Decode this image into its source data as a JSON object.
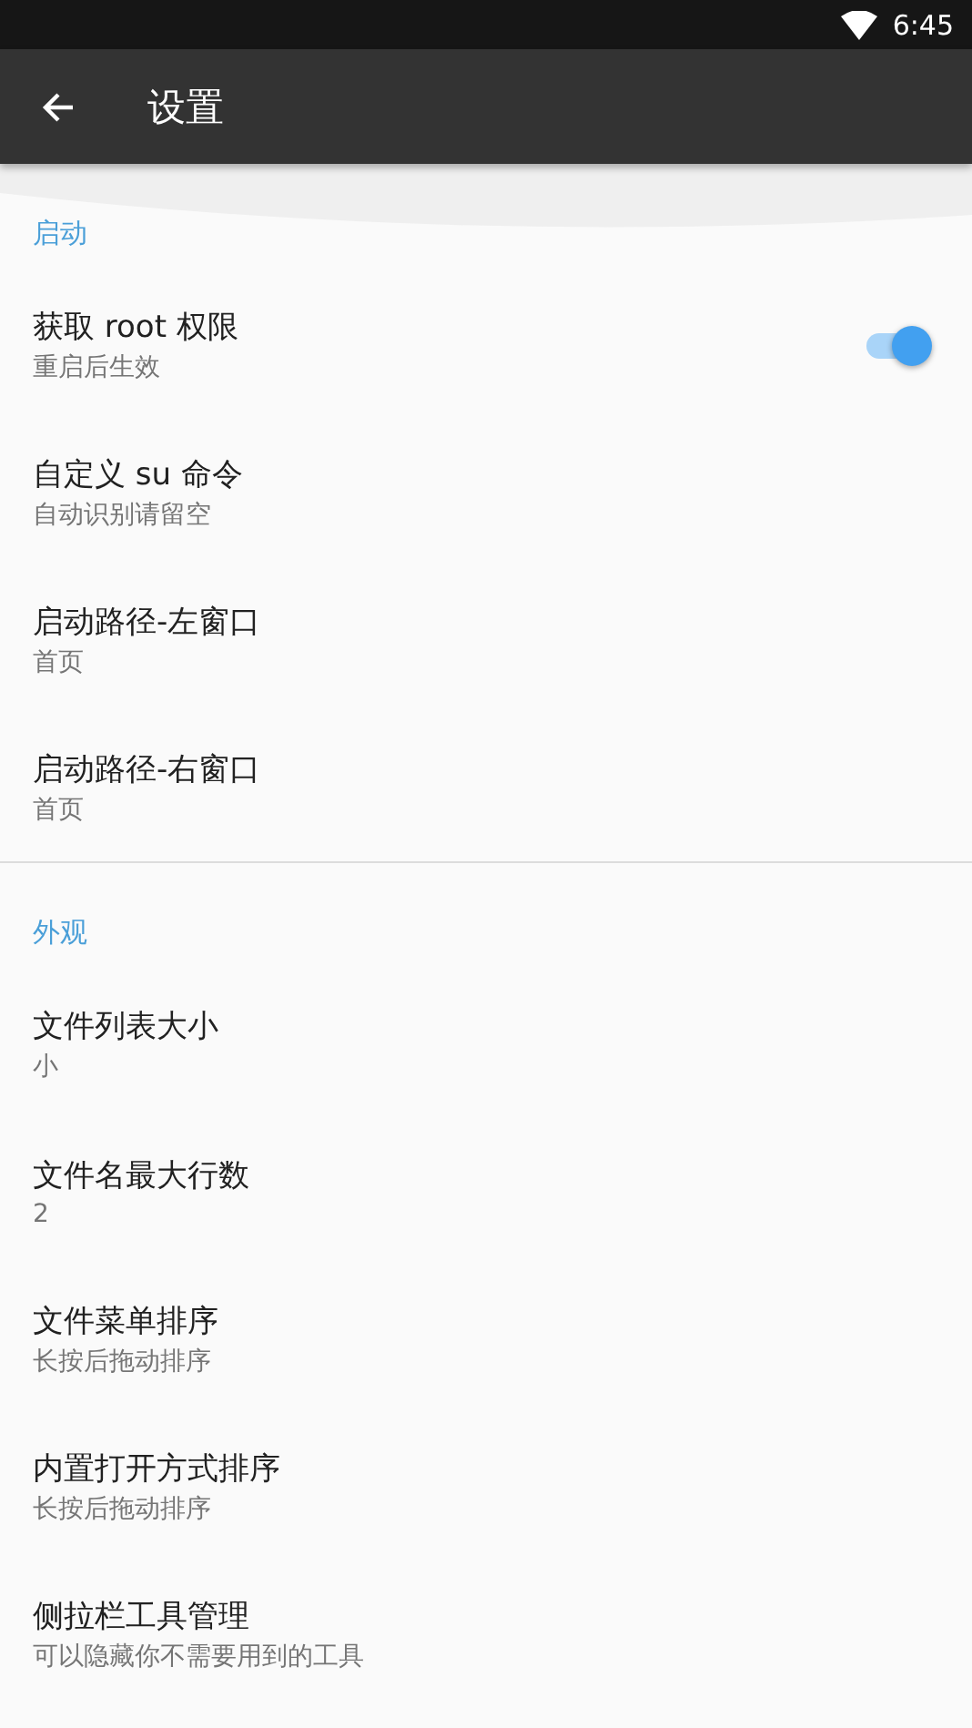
{
  "status_bar": {
    "time": "6:45"
  },
  "toolbar": {
    "title": "设置"
  },
  "sections": [
    {
      "header": "启动",
      "items": [
        {
          "kind": "switch",
          "title": "获取 root 权限",
          "subtitle": "重启后生效",
          "on": true
        },
        {
          "kind": "plain",
          "title": "自定义 su 命令",
          "subtitle": "自动识别请留空"
        },
        {
          "kind": "plain",
          "title": "启动路径-左窗口",
          "subtitle": "首页"
        },
        {
          "kind": "plain",
          "title": "启动路径-右窗口",
          "subtitle": "首页"
        }
      ]
    },
    {
      "header": "外观",
      "items": [
        {
          "kind": "plain",
          "title": "文件列表大小",
          "subtitle": "小"
        },
        {
          "kind": "plain",
          "title": "文件名最大行数",
          "subtitle": "2"
        },
        {
          "kind": "plain",
          "title": "文件菜单排序",
          "subtitle": "长按后拖动排序"
        },
        {
          "kind": "plain",
          "title": "内置打开方式排序",
          "subtitle": "长按后拖动排序"
        },
        {
          "kind": "plain",
          "title": "侧拉栏工具管理",
          "subtitle": "可以隐藏你不需要用到的工具"
        }
      ]
    }
  ]
}
